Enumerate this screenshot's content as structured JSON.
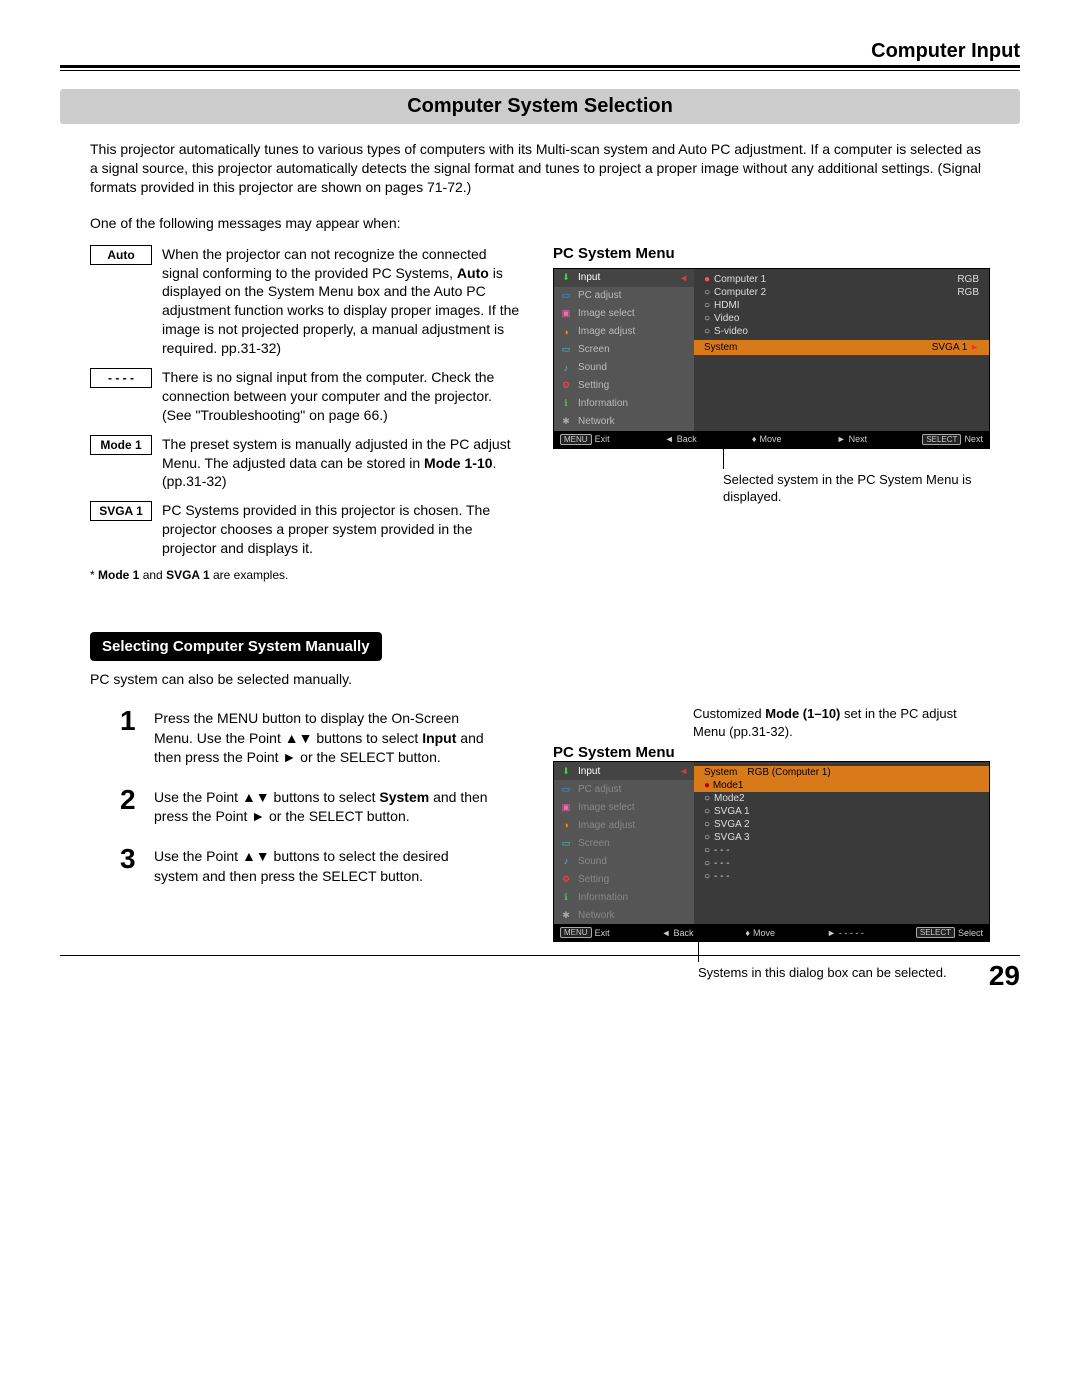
{
  "header": {
    "chapter": "Computer Input"
  },
  "section": {
    "title": "Computer System Selection"
  },
  "intro": "This projector automatically tunes to various types of computers with its Multi-scan system and Auto PC adjustment. If a computer is selected as a signal source, this projector automatically detects the signal format and tunes to project a proper image without any additional settings. (Signal formats provided in this projector are shown on pages 71-72.)",
  "lead": "One of the following messages may appear when:",
  "messages": {
    "auto": {
      "label": "Auto",
      "text_a": "When the projector can not recognize the connected signal conforming to the provided PC Systems, ",
      "text_b": " is displayed on the System Menu box and the Auto PC adjustment function works to display proper images. If the image is not projected properly, a manual adjustment is required.   pp.31-32)",
      "bold": "Auto"
    },
    "dashes": {
      "label": "- - - -",
      "text": "There is no signal input from the computer. Check the connection between your computer and the projector.  (See \"Troubleshooting\" on page 66.)"
    },
    "mode1": {
      "label": "Mode 1",
      "text_a": "The preset system is manually adjusted in the PC adjust Menu. The adjusted data can be stored in ",
      "bold": "Mode 1-10",
      "text_b": ".   (pp.31-32)"
    },
    "svga1": {
      "label": "SVGA 1",
      "text": "PC Systems provided in this projector is chosen. The projector chooses a proper system provided in the projector and displays it."
    }
  },
  "note": {
    "prefix": "* ",
    "b1": "Mode 1",
    "mid": " and ",
    "b2": "SVGA 1",
    "suffix": " are examples."
  },
  "sub": {
    "title": "Selecting Computer System Manually"
  },
  "manual_lead": "PC system can also be selected manually.",
  "steps": {
    "s1": {
      "num": "1",
      "text_a": "Press the MENU button to display the On-Screen Menu. Use the Point ▲▼ buttons to select ",
      "b1": "Input",
      "text_b": " and then press the Point ► or the SELECT button."
    },
    "s2": {
      "num": "2",
      "text_a": "Use the Point ▲▼ buttons to select ",
      "b1": "System",
      "text_b": " and then press the Point ► or the SELECT button."
    },
    "s3": {
      "num": "3",
      "text": "Use the Point ▲▼ buttons to select the desired system and then press the SELECT button."
    }
  },
  "menu1": {
    "title": "PC System Menu",
    "left": {
      "input": "Input",
      "pcadjust": "PC adjust",
      "imgselect": "Image select",
      "imgadjust": "Image adjust",
      "screen": "Screen",
      "sound": "Sound",
      "setting": "Setting",
      "info": "Information",
      "network": "Network"
    },
    "right": {
      "computer1": "Computer 1",
      "computer1_val": "RGB",
      "computer2": "Computer 2",
      "computer2_val": "RGB",
      "hdmi": "HDMI",
      "video": "Video",
      "svideo": "S-video",
      "system_label": "System",
      "system_val": "SVGA 1"
    },
    "footer": {
      "exit": "Exit",
      "back": "Back",
      "move": "Move",
      "next": "Next",
      "next2": "Next",
      "menu": "MENU",
      "select": "SELECT"
    },
    "callout": "Selected system in the PC System Menu is displayed."
  },
  "menu2": {
    "title": "PC System Menu",
    "top_callout_a": "Customized ",
    "top_callout_b": "Mode (1–10)",
    "top_callout_c": " set in the PC adjust Menu (pp.31-32).",
    "header": {
      "system": "System",
      "src": "RGB (Computer 1)"
    },
    "options": {
      "mode1": "Mode1",
      "mode2": "Mode2",
      "svga1": "SVGA 1",
      "svga2": "SVGA 2",
      "svga3": "SVGA 3",
      "dash": "- - -"
    },
    "footer": {
      "exit": "Exit",
      "back": "Back",
      "move": "Move",
      "dashes": "- - - - -",
      "select": "Select",
      "menu": "MENU",
      "selectk": "SELECT"
    },
    "callout": "Systems in this dialog box can be selected."
  },
  "page_number": "29"
}
